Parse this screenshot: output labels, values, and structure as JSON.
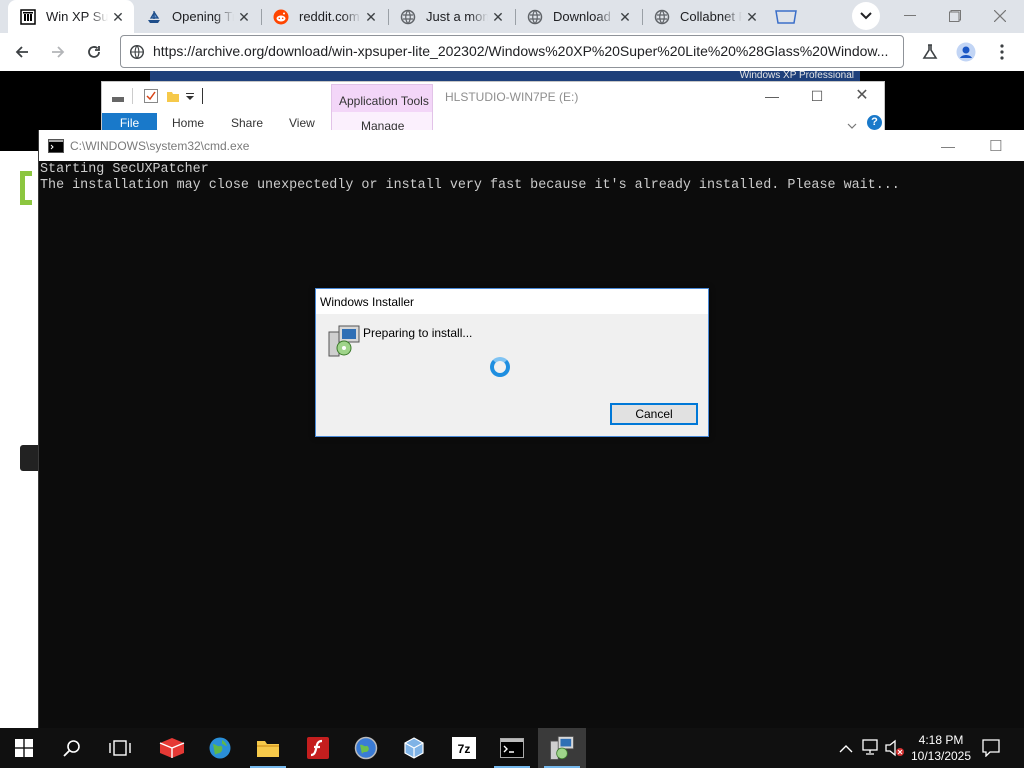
{
  "browser": {
    "tabs": [
      {
        "label": "Win XP Super Lite",
        "icon": "archive-icon",
        "active": true
      },
      {
        "label": "Opening Tr",
        "icon": "ship-icon"
      },
      {
        "label": "reddit.com",
        "icon": "reddit-icon"
      },
      {
        "label": "Just a mom",
        "icon": "globe-icon"
      },
      {
        "label": "Download",
        "icon": "globe-icon"
      },
      {
        "label": "Collabnet R",
        "icon": "globe-icon"
      }
    ],
    "url": "https://archive.org/download/win-xpsuper-lite_202302/Windows%20XP%20Super%20Lite%20%28Glass%20Window..."
  },
  "page": {
    "banner_text": "Windows XP Professional"
  },
  "explorer": {
    "title": "HLSTUDIO-WIN7PE (E:)",
    "context_tab": "Application Tools",
    "context_sub": "Manage",
    "ribbon_tabs": [
      "File",
      "Home",
      "Share",
      "View"
    ]
  },
  "cmd": {
    "title": "C:\\WINDOWS\\system32\\cmd.exe",
    "lines": [
      "Starting SecUXPatcher",
      "The installation may close unexpectedly or install very fast because it's already installed. Please wait..."
    ]
  },
  "installer": {
    "title": "Windows Installer",
    "message": "Preparing to install...",
    "cancel_label": "Cancel"
  },
  "taskbar": {
    "time": "4:18 PM",
    "date": "10/13/2025"
  },
  "colors": {
    "accent": "#0078d7",
    "ribbon_file": "#1979ca",
    "app_tools": "#f3d6f8"
  }
}
